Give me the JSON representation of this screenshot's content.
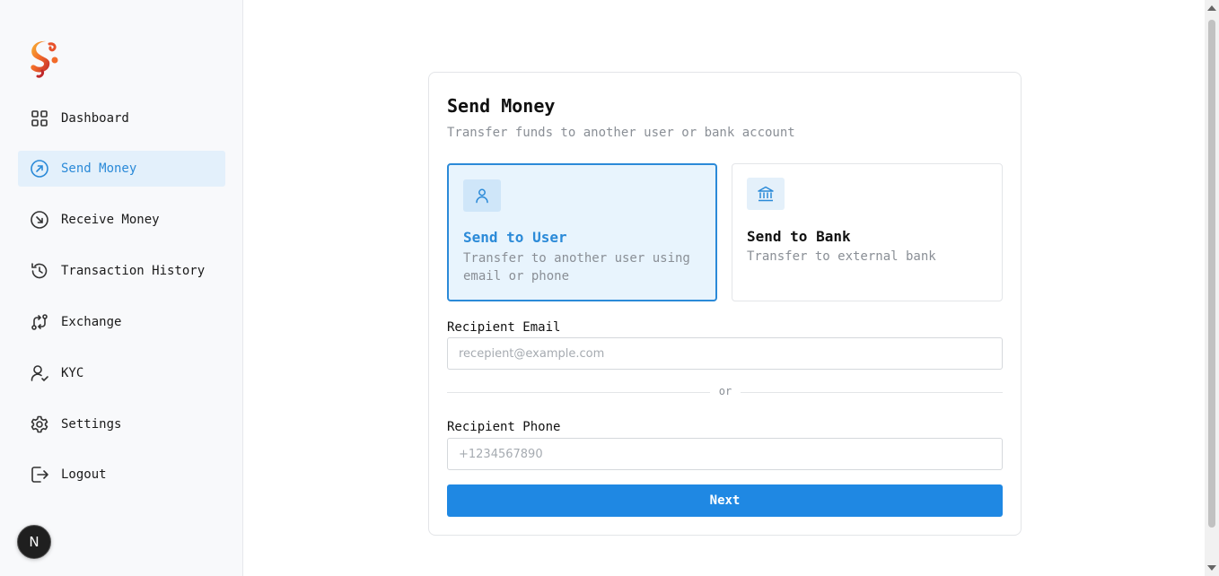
{
  "sidebar": {
    "items": [
      {
        "label": "Dashboard",
        "icon": "dashboard-grid-icon"
      },
      {
        "label": "Send Money",
        "icon": "arrow-up-right-circle-icon",
        "active": true
      },
      {
        "label": "Receive Money",
        "icon": "arrow-down-right-circle-icon"
      },
      {
        "label": "Transaction History",
        "icon": "history-icon"
      },
      {
        "label": "Exchange",
        "icon": "exchange-icon"
      },
      {
        "label": "KYC",
        "icon": "user-check-icon"
      },
      {
        "label": "Settings",
        "icon": "gear-icon"
      },
      {
        "label": "Logout",
        "icon": "logout-icon"
      }
    ],
    "avatar_letter": "N"
  },
  "send": {
    "title": "Send Money",
    "subtitle": "Transfer funds to another user or bank account",
    "options": [
      {
        "title": "Send to User",
        "desc": "Transfer to another user using email or phone",
        "icon": "user-icon",
        "selected": true
      },
      {
        "title": "Send to Bank",
        "desc": "Transfer to external bank",
        "icon": "bank-icon",
        "selected": false
      }
    ],
    "email_label": "Recipient Email",
    "email_placeholder": "recepient@example.com",
    "email_value": "",
    "or_text": "or",
    "phone_label": "Recipient Phone",
    "phone_placeholder": "+1234567890",
    "phone_value": "",
    "next_label": "Next"
  },
  "colors": {
    "accent": "#1f88e3",
    "active_bg": "#e3f0fb",
    "active_text": "#2b8ad8"
  }
}
